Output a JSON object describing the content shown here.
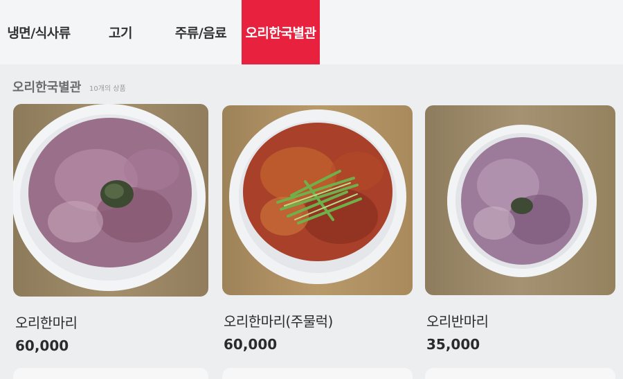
{
  "tabs": [
    {
      "label": "냉면/식사류",
      "active": false
    },
    {
      "label": "고기",
      "active": false
    },
    {
      "label": "주류/음료",
      "active": false
    },
    {
      "label": "오리한국별관",
      "active": true
    }
  ],
  "section": {
    "title": "오리한국별관",
    "count": "10개의 상품"
  },
  "products": [
    {
      "name": "오리한마리",
      "price": "60,000",
      "image": "raw-duck-plate"
    },
    {
      "name": "오리한마리(주물럭)",
      "price": "60,000",
      "image": "marinated-duck-plate"
    },
    {
      "name": "오리반마리",
      "price": "35,000",
      "image": "raw-duck-half-plate"
    }
  ],
  "colors": {
    "accent": "#e8213f",
    "background": "#eceef0"
  }
}
